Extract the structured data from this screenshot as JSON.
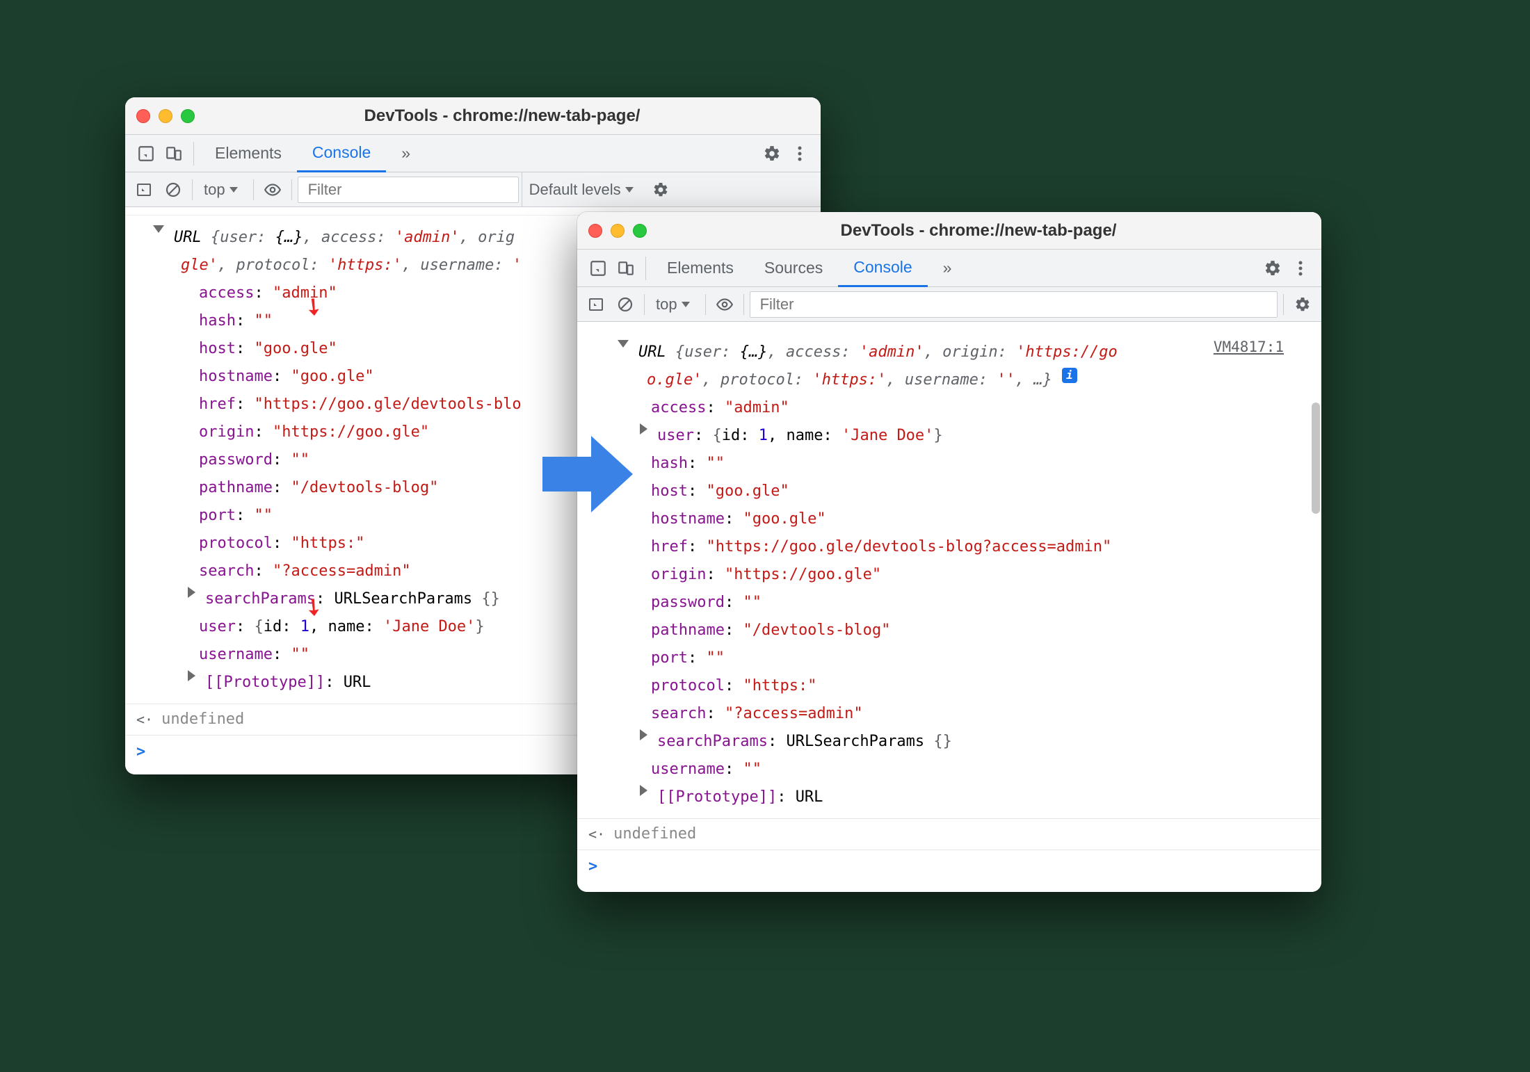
{
  "window1": {
    "title": "DevTools - chrome://new-tab-page/",
    "tabs": [
      "Elements",
      "Console"
    ],
    "activeTab": "Console",
    "more": "»",
    "context": "top",
    "filterPlaceholder": "Filter",
    "levels": "Default levels",
    "summary": {
      "class": "URL",
      "line1a": "{user: ",
      "line1b": "{…}",
      "line1c": ", access: ",
      "line1d": "'admin'",
      "line1e": ", orig",
      "line2a": "gle'",
      "line2b": ", protocol: ",
      "line2c": "'https:'",
      "line2d": ", username: ",
      "line2e": "'"
    },
    "props": {
      "access": {
        "k": "access",
        "v": "\"admin\""
      },
      "hash": {
        "k": "hash",
        "v": "\"\""
      },
      "host": {
        "k": "host",
        "v": "\"goo.gle\""
      },
      "hostname": {
        "k": "hostname",
        "v": "\"goo.gle\""
      },
      "href": {
        "k": "href",
        "v": "\"https://goo.gle/devtools-blo"
      },
      "origin": {
        "k": "origin",
        "v": "\"https://goo.gle\""
      },
      "password": {
        "k": "password",
        "v": "\"\""
      },
      "pathname": {
        "k": "pathname",
        "v": "\"/devtools-blog\""
      },
      "port": {
        "k": "port",
        "v": "\"\""
      },
      "protocol": {
        "k": "protocol",
        "v": "\"https:\""
      },
      "search": {
        "k": "search",
        "v": "\"?access=admin\""
      },
      "searchParams": {
        "k": "searchParams",
        "class": "URLSearchParams",
        "braces": "{}"
      },
      "user": {
        "k": "user",
        "id_k": "id",
        "id_v": "1",
        "name_k": "name",
        "name_v": "'Jane Doe'"
      },
      "username": {
        "k": "username",
        "v": "\"\""
      },
      "proto": {
        "k": "[[Prototype]]",
        "v": "URL"
      }
    },
    "result": "undefined"
  },
  "window2": {
    "title": "DevTools - chrome://new-tab-page/",
    "tabs": [
      "Elements",
      "Sources",
      "Console"
    ],
    "activeTab": "Console",
    "more": "»",
    "context": "top",
    "filterPlaceholder": "Filter",
    "sourceLink": "VM4817:1",
    "summary": {
      "class": "URL",
      "line1a": "{user: ",
      "line1b": "{…}",
      "line1c": ", access: ",
      "line1d": "'admin'",
      "line1e": ", origin: ",
      "line1f": "'https://go",
      "line2a": "o.gle'",
      "line2b": ", protocol: ",
      "line2c": "'https:'",
      "line2d": ", username: ",
      "line2e": "''",
      "line2f": ", …}"
    },
    "props": {
      "access": {
        "k": "access",
        "v": "\"admin\""
      },
      "user": {
        "k": "user",
        "id_k": "id",
        "id_v": "1",
        "name_k": "name",
        "name_v": "'Jane Doe'"
      },
      "hash": {
        "k": "hash",
        "v": "\"\""
      },
      "host": {
        "k": "host",
        "v": "\"goo.gle\""
      },
      "hostname": {
        "k": "hostname",
        "v": "\"goo.gle\""
      },
      "href": {
        "k": "href",
        "v": "\"https://goo.gle/devtools-blog?access=admin\""
      },
      "origin": {
        "k": "origin",
        "v": "\"https://goo.gle\""
      },
      "password": {
        "k": "password",
        "v": "\"\""
      },
      "pathname": {
        "k": "pathname",
        "v": "\"/devtools-blog\""
      },
      "port": {
        "k": "port",
        "v": "\"\""
      },
      "protocol": {
        "k": "protocol",
        "v": "\"https:\""
      },
      "search": {
        "k": "search",
        "v": "\"?access=admin\""
      },
      "searchParams": {
        "k": "searchParams",
        "class": "URLSearchParams",
        "braces": "{}"
      },
      "username": {
        "k": "username",
        "v": "\"\""
      },
      "proto": {
        "k": "[[Prototype]]",
        "v": "URL"
      }
    },
    "result": "undefined"
  }
}
